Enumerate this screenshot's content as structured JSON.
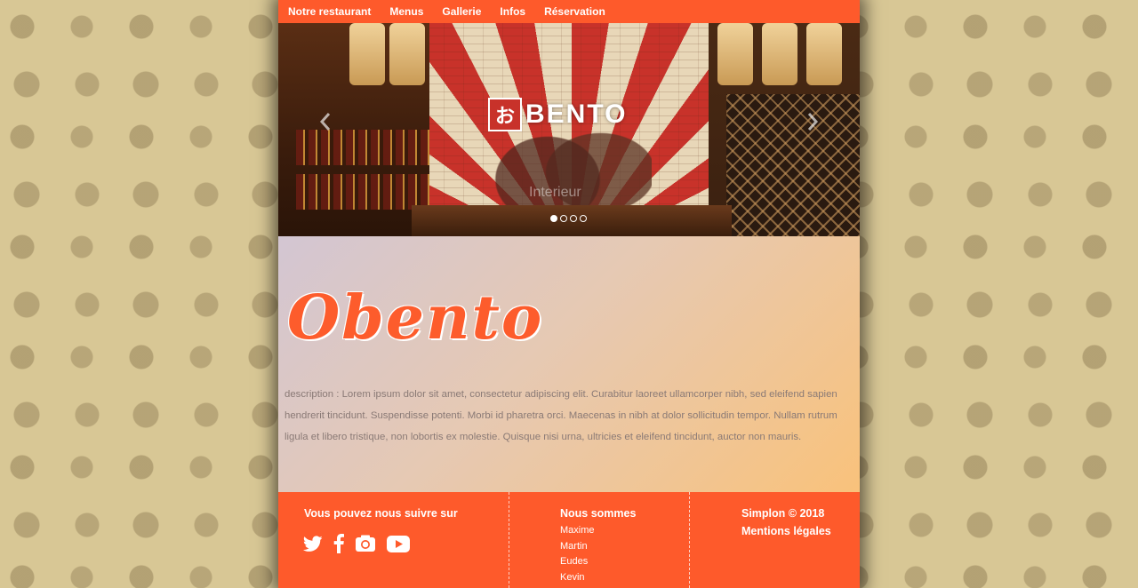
{
  "nav": {
    "items": [
      "Notre restaurant",
      "Menus",
      "Gallerie",
      "Infos",
      "Réservation"
    ]
  },
  "carousel": {
    "logo_mark": "お",
    "logo_word": "BENTO",
    "caption": "Interieur",
    "slide_count": 4,
    "active_slide": 1
  },
  "main": {
    "brand": "Obento",
    "description": "description : Lorem ipsum dolor sit amet, consectetur adipiscing elit. Curabitur laoreet ullamcorper nibh, sed eleifend sapien hendrerit tincidunt. Suspendisse potenti. Morbi id pharetra orci. Maecenas in nibh at dolor sollicitudin tempor. Nullam rutrum ligula et libero tristique, non lobortis ex molestie. Quisque nisi urna, ultricies et eleifend tincidunt, auctor non mauris."
  },
  "footer": {
    "follow_title": "Vous pouvez nous suivre sur",
    "social_icons": [
      "twitter-icon",
      "facebook-icon",
      "instagram-icon",
      "youtube-icon"
    ],
    "team_title": "Nous sommes",
    "members": [
      "Maxime",
      "Martin",
      "Eudes",
      "Kevin"
    ],
    "copyright": "Simplon © 2018",
    "legal": "Mentions légales"
  },
  "colors": {
    "accent": "#fe5a2b",
    "background": "#d8c795",
    "brand_text": "#fd5c2c"
  }
}
